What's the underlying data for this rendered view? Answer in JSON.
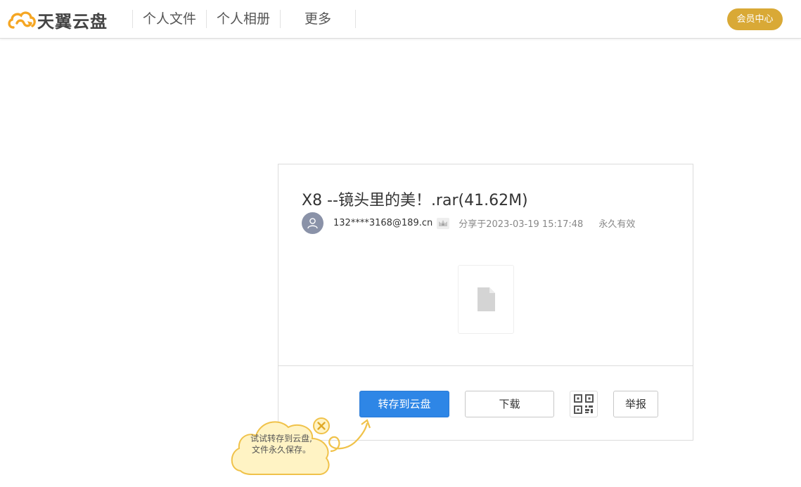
{
  "header": {
    "brand": "天翼云盘",
    "nav": [
      "个人文件",
      "个人相册",
      "更多"
    ],
    "vip_label": "会员中心"
  },
  "share": {
    "title": "X8 --镜头里的美！.rar(41.62M)",
    "user": "132****3168@189.cn",
    "share_time": "分享于2023-03-19 15:17:48",
    "validity": "永久有效",
    "save_label": "转存到云盘",
    "download_label": "下载",
    "report_label": "举报"
  },
  "tip": {
    "line1": "试试转存到云盘,",
    "line2": "文件永久保存。"
  },
  "colors": {
    "accent": "#2e86e6",
    "vip": "#d9a936",
    "logo": "#f5a623",
    "tip_bg": "#fff3c4",
    "tip_border": "#f0c24a"
  },
  "icons": {
    "logo": "cloud-logo-icon",
    "avatar": "user-icon",
    "crown": "crown-icon",
    "file": "file-icon",
    "qr": "qr-code-icon",
    "close": "close-icon"
  }
}
